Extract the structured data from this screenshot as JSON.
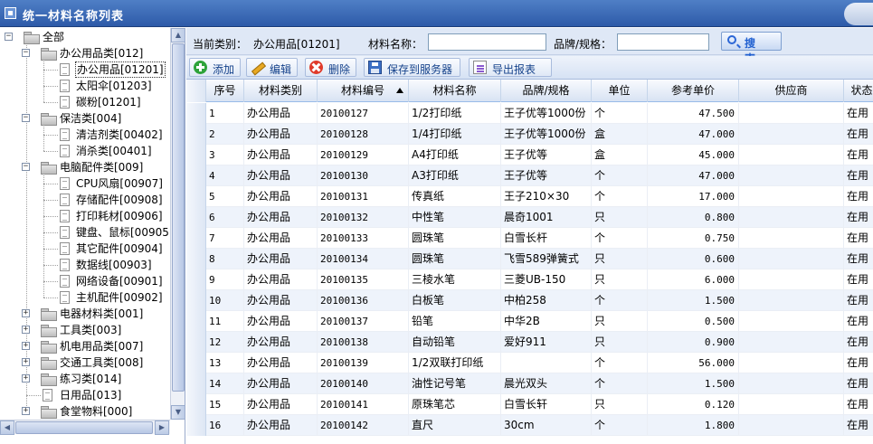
{
  "window": {
    "title": "统一材料名称列表"
  },
  "tree": {
    "nodes": [
      {
        "label": "全部",
        "depth": 0,
        "type": "folder",
        "expanded": true
      },
      {
        "label": "办公用品类[012]",
        "depth": 1,
        "type": "folder",
        "expanded": true
      },
      {
        "label": "办公用品[01201]",
        "depth": 2,
        "type": "doc",
        "selected": true
      },
      {
        "label": "太阳伞[01203]",
        "depth": 2,
        "type": "doc"
      },
      {
        "label": "碳粉[01201]",
        "depth": 2,
        "type": "doc"
      },
      {
        "label": "保洁类[004]",
        "depth": 1,
        "type": "folder",
        "expanded": true
      },
      {
        "label": "清洁剂类[00402]",
        "depth": 2,
        "type": "doc"
      },
      {
        "label": "消杀类[00401]",
        "depth": 2,
        "type": "doc"
      },
      {
        "label": "电脑配件类[009]",
        "depth": 1,
        "type": "folder",
        "expanded": true
      },
      {
        "label": "CPU风扇[00907]",
        "depth": 2,
        "type": "doc"
      },
      {
        "label": "存储配件[00908]",
        "depth": 2,
        "type": "doc"
      },
      {
        "label": "打印耗材[00906]",
        "depth": 2,
        "type": "doc"
      },
      {
        "label": "键盘、鼠标[00905]",
        "depth": 2,
        "type": "doc"
      },
      {
        "label": "其它配件[00904]",
        "depth": 2,
        "type": "doc"
      },
      {
        "label": "数据线[00903]",
        "depth": 2,
        "type": "doc"
      },
      {
        "label": "网络设备[00901]",
        "depth": 2,
        "type": "doc"
      },
      {
        "label": "主机配件[00902]",
        "depth": 2,
        "type": "doc"
      },
      {
        "label": "电器材料类[001]",
        "depth": 1,
        "type": "folder",
        "expanded": false
      },
      {
        "label": "工具类[003]",
        "depth": 1,
        "type": "folder",
        "expanded": false
      },
      {
        "label": "机电用品类[007]",
        "depth": 1,
        "type": "folder",
        "expanded": false
      },
      {
        "label": "交通工具类[008]",
        "depth": 1,
        "type": "folder",
        "expanded": false
      },
      {
        "label": "练习类[014]",
        "depth": 1,
        "type": "folder",
        "expanded": false
      },
      {
        "label": "日用品[013]",
        "depth": 1,
        "type": "doc"
      },
      {
        "label": "食堂物料[000]",
        "depth": 1,
        "type": "folder",
        "expanded": false
      }
    ]
  },
  "search": {
    "category_label": "当前类别：",
    "category_value": "办公用品[01201]",
    "name_label": "材料名称：",
    "name_value": "",
    "brand_label": "品牌/规格：",
    "brand_value": "",
    "button_label": "搜 索"
  },
  "toolbar": {
    "add": "添加",
    "edit": "编辑",
    "delete": "删除",
    "save": "保存到服务器",
    "export": "导出报表"
  },
  "grid": {
    "columns": [
      "序号",
      "材料类别",
      "材料编号",
      "材料名称",
      "品牌/规格",
      "单位",
      "参考单价",
      "供应商",
      "状态"
    ],
    "sorted_column": "材料编号",
    "sort_direction": "asc",
    "rows": [
      [
        "1",
        "办公用品",
        "20100127",
        "1/2打印纸",
        "王子优等1000份",
        "个",
        "47.500",
        "",
        "在用"
      ],
      [
        "2",
        "办公用品",
        "20100128",
        "1/4打印纸",
        "王子优等1000份",
        "盒",
        "47.000",
        "",
        "在用"
      ],
      [
        "3",
        "办公用品",
        "20100129",
        "A4打印纸",
        "王子优等",
        "盒",
        "45.000",
        "",
        "在用"
      ],
      [
        "4",
        "办公用品",
        "20100130",
        "A3打印纸",
        "王子优等",
        "个",
        "47.000",
        "",
        "在用"
      ],
      [
        "5",
        "办公用品",
        "20100131",
        "传真纸",
        "王子210×30",
        "个",
        "17.000",
        "",
        "在用"
      ],
      [
        "6",
        "办公用品",
        "20100132",
        "中性笔",
        "晨奇1001",
        "只",
        "0.800",
        "",
        "在用"
      ],
      [
        "7",
        "办公用品",
        "20100133",
        "圆珠笔",
        "白雪长杆",
        "个",
        "0.750",
        "",
        "在用"
      ],
      [
        "8",
        "办公用品",
        "20100134",
        "圆珠笔",
        "飞雪589弹簧式",
        "只",
        "0.600",
        "",
        "在用"
      ],
      [
        "9",
        "办公用品",
        "20100135",
        "三棱水笔",
        "三菱UB-150",
        "只",
        "6.000",
        "",
        "在用"
      ],
      [
        "10",
        "办公用品",
        "20100136",
        "白板笔",
        "中柏258",
        "个",
        "1.500",
        "",
        "在用"
      ],
      [
        "11",
        "办公用品",
        "20100137",
        "铅笔",
        "中华2B",
        "只",
        "0.500",
        "",
        "在用"
      ],
      [
        "12",
        "办公用品",
        "20100138",
        "自动铅笔",
        "爱好911",
        "只",
        "0.900",
        "",
        "在用"
      ],
      [
        "13",
        "办公用品",
        "20100139",
        "1/2双联打印纸",
        "",
        "个",
        "56.000",
        "",
        "在用"
      ],
      [
        "14",
        "办公用品",
        "20100140",
        "油性记号笔",
        "晨光双头",
        "个",
        "1.500",
        "",
        "在用"
      ],
      [
        "15",
        "办公用品",
        "20100141",
        "原珠笔芯",
        "白雪长轩",
        "只",
        "0.120",
        "",
        "在用"
      ],
      [
        "16",
        "办公用品",
        "20100142",
        "直尺",
        "30cm",
        "个",
        "1.800",
        "",
        "在用"
      ]
    ]
  }
}
